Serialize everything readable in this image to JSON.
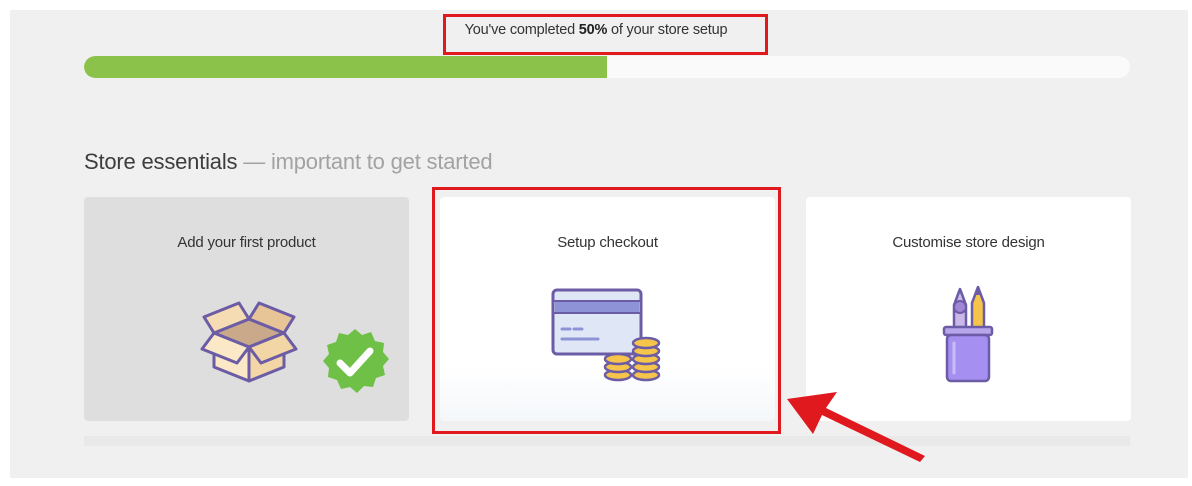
{
  "progress": {
    "text_before": "You've completed ",
    "percent_text": "50%",
    "text_after": " of your store setup",
    "percent": 50,
    "fill_color": "#8bc34a"
  },
  "section": {
    "title": "Store essentials",
    "subtitle": " — important to get started"
  },
  "cards": [
    {
      "label": "Add your first product",
      "icon": "open-box-icon",
      "status": "completed",
      "badge_icon": "checkmark-badge-icon"
    },
    {
      "label": "Setup checkout",
      "icon": "credit-card-coins-icon",
      "status": "highlighted"
    },
    {
      "label": "Customise store design",
      "icon": "pencil-cup-icon",
      "status": "pending"
    }
  ],
  "annotations": {
    "highlight_color": "#e0191f",
    "arrow_icon": "red-arrow-icon"
  }
}
